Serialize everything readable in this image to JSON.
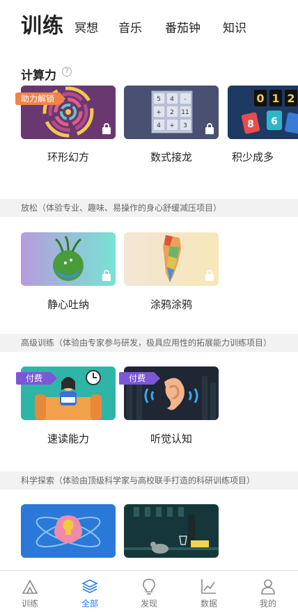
{
  "tabs": [
    {
      "label": "训练",
      "active": true
    },
    {
      "label": "冥想"
    },
    {
      "label": "音乐"
    },
    {
      "label": "番茄钟"
    },
    {
      "label": "知识"
    }
  ],
  "section_calc": {
    "title": "计算力",
    "help_icon": "?",
    "cards": [
      {
        "label": "环形幻方",
        "badge": "助力解锁",
        "locked": true
      },
      {
        "label": "数式接龙",
        "locked": true,
        "grid": [
          "5",
          "4",
          "-",
          "+",
          "2",
          "11",
          "4",
          "+",
          "3"
        ]
      },
      {
        "label": "积少成多",
        "digits": [
          "0",
          "1",
          "2"
        ],
        "cards": [
          "8",
          "6"
        ]
      }
    ]
  },
  "section_relax": {
    "description": "放松（体验专业、趣味、易操作的身心舒缓减压项目）",
    "cards": [
      {
        "label": "静心吐纳",
        "locked": true
      },
      {
        "label": "涂鸦涂鸦",
        "locked": true
      }
    ]
  },
  "section_advanced": {
    "description": "高级训练（体验由专家参与研发，极具应用性的拓展能力训练项目）",
    "cards": [
      {
        "label": "速读能力",
        "badge": "付费"
      },
      {
        "label": "听觉认知",
        "badge": "付费"
      }
    ]
  },
  "section_science": {
    "description": "科学探索（体验由顶级科学家与高校联手打造的科研训练项目）",
    "cards": [
      {
        "label": ""
      },
      {
        "label": ""
      }
    ]
  },
  "bottom_nav": [
    {
      "label": "训练",
      "icon": "tent-icon"
    },
    {
      "label": "全部",
      "icon": "layers-icon",
      "active": true
    },
    {
      "label": "发现",
      "icon": "bulb-icon"
    },
    {
      "label": "数据",
      "icon": "chart-icon"
    },
    {
      "label": "我的",
      "icon": "user-icon"
    }
  ],
  "colors": {
    "accent": "#2c7be5",
    "pay_badge": "#7c58d8",
    "help_badge": "#f0834a"
  }
}
